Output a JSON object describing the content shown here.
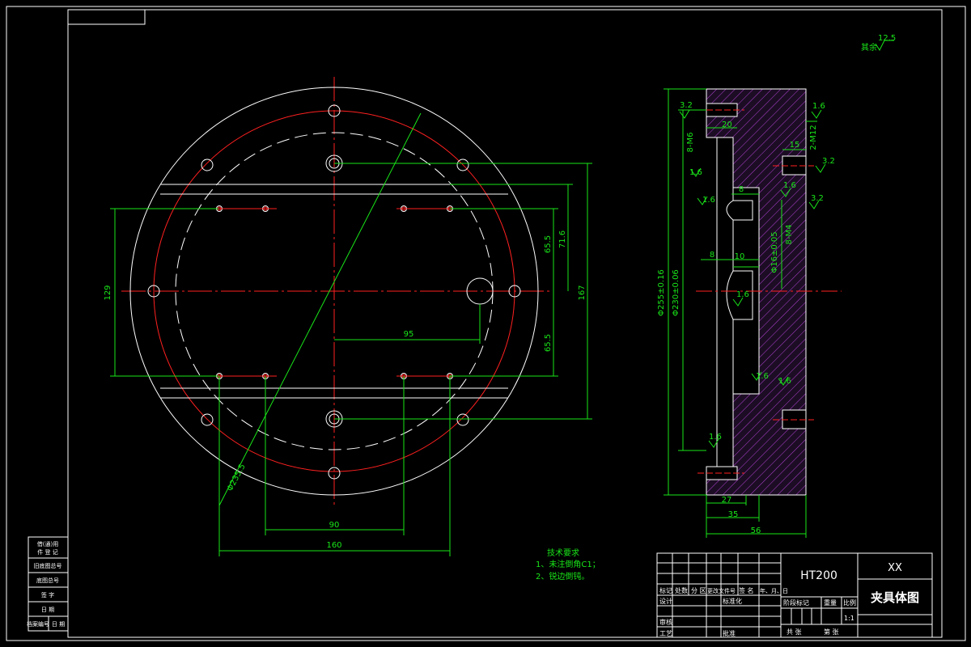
{
  "material": "HT200",
  "part_code": "XX",
  "drawing_name": "夹具体图",
  "scale": "1:1",
  "remaining_roughness": "12.5",
  "dimensions": {
    "plan": {
      "d_bolt_circle": "Φ235.5",
      "d129": "129",
      "d167": "167",
      "d65_5_upper": "65.5",
      "d71_6": "71.6",
      "d65_5_lower": "65.5",
      "d95": "95",
      "d90": "90",
      "d160": "160"
    },
    "section": {
      "d20": "20",
      "d2_M12": "2-M12",
      "d15": "15",
      "d8_M6": "8-M6",
      "d8_top": "8",
      "d8_M4": "8-M4",
      "d8_mid": "8",
      "d10": "10",
      "d_phi16": "Φ16±0.05",
      "d_phi255": "Φ255±0.16",
      "d_phi230": "Φ230±0.06",
      "d27": "27",
      "d35": "35",
      "d56": "56"
    },
    "roughness": {
      "r1": "3.2",
      "r2": "1.6",
      "r3": "3.2",
      "r4": "1.6",
      "r5": "1.6",
      "r6": "1.6",
      "r7": "3.2",
      "r8": "1.6",
      "r9": "1.6",
      "r10": "1.6",
      "r11": "1.6"
    }
  },
  "tech_notes": {
    "title": "技术要求",
    "line1": "1、未注倒角C1；",
    "line2": "2、锐边倒钝。"
  },
  "title_block": {
    "col_marks": "标记",
    "col_count": "处数",
    "col_zone": "分 区",
    "col_docno": "更改文件号",
    "col_sign": "签 名",
    "col_date": "年、月、日",
    "design": "设计",
    "standardize": "标准化",
    "review": "审核",
    "process": "工艺",
    "approve": "批准",
    "stage_mark": "阶段标记",
    "weight": "重量",
    "scale_label": "比例",
    "sheets_total": "共    张",
    "sheet_no": "第    张"
  },
  "side_table": {
    "row1a": "借(通)用",
    "row1b": "件 登 记",
    "row2": "旧底图总号",
    "row3": "底图总号",
    "row4": "签    字",
    "row5": "日    期",
    "row6a": "档案编号",
    "row6b": "日 期"
  }
}
